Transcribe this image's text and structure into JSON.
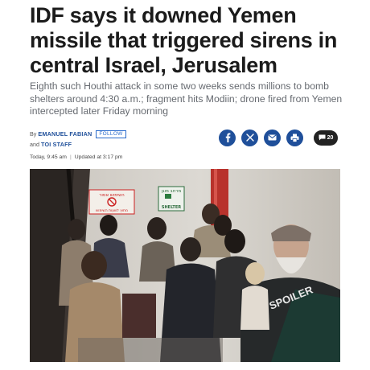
{
  "article": {
    "headline": "IDF says it downed Yemen missile that triggered sirens in central Israel, Jerusalem",
    "subheadline": "Eighth such Houthi attack in some two weeks sends millions to bomb shelters around 4:30 a.m.; fragment hits Modiin; drone fired from Yemen intercepted later Friday morning"
  },
  "byline": {
    "by_prefix": "By",
    "author_1": "EMANUEL FABIAN",
    "follow_label": "FOLLOW",
    "and_prefix": "and",
    "author_2": "TOI STAFF",
    "published": "Today, 9:45 am",
    "separator": "|",
    "updated": "Updated at 3:17 pm"
  },
  "share": {
    "icons": [
      "facebook-icon",
      "x-icon",
      "email-icon",
      "print-icon"
    ],
    "comment_count": "20",
    "brand_color": "#1f4f9a"
  },
  "photo": {
    "sign_left_line1": "השימוש אסור",
    "sign_left_line2": "מחוץ לשעות השימוש",
    "sign_right_line1": "מרחב מוגן",
    "sign_right_line2": "SHELTER",
    "shirt_text": "SPOILER"
  }
}
